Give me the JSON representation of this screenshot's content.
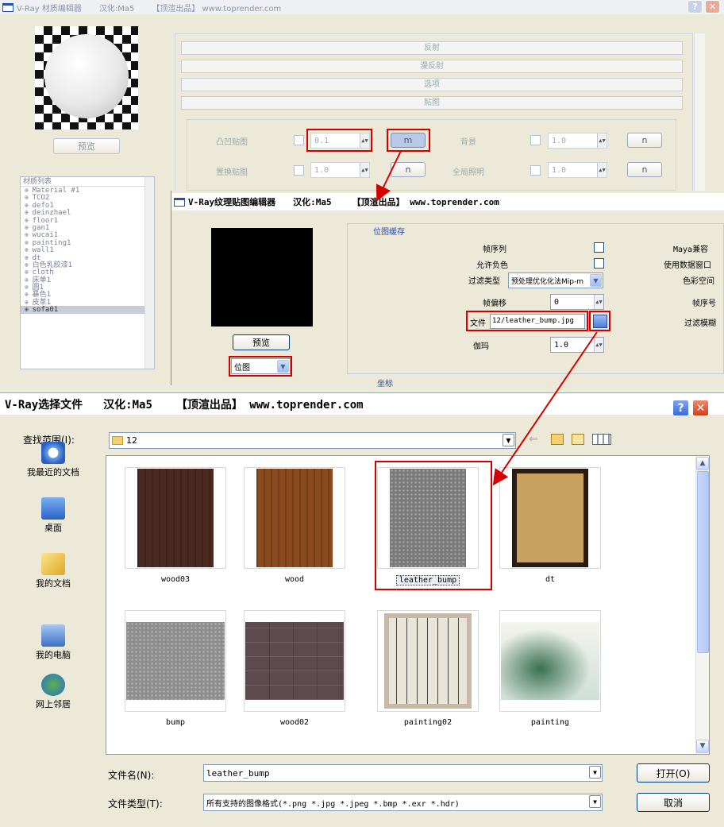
{
  "material_editor": {
    "title": "V-Ray 材质编辑器",
    "credit": "汉化:Ma5",
    "tag": "【顶渲出品】 www.toprender.com",
    "preview_button": "预览",
    "rollouts": [
      "反射",
      "漫反射",
      "选项",
      "贴图"
    ],
    "maps": {
      "bump_label": "凸凹贴图",
      "bump_value": "0.1",
      "displace_label": "置换贴图",
      "displace_value": "1.0",
      "background_label": "背景",
      "background_value": "1.0",
      "gi_label": "全局照明",
      "gi_value": "1.0",
      "map_button": "m",
      "none_button": "n"
    },
    "material_list_header": "材质列表",
    "material_list": [
      "Material #1",
      "TCO2",
      "defo1",
      "deinzhael",
      "floor1",
      "gan1",
      "wucai1",
      "painting1",
      "wall1",
      "dt",
      "白色乳胶漆1",
      "cloth",
      "床单1",
      "圆1",
      "暴色1",
      "皮革1",
      "sofa01"
    ],
    "material_selected": "sofa01"
  },
  "texture_editor": {
    "title": "V-Ray纹理贴图编辑器",
    "credit": "汉化:Ma5",
    "tag": "【顶渲出品】 www.toprender.com",
    "preview_button": "预览",
    "type_select": "位图",
    "group_label": "位图缓存",
    "rows": {
      "frame_seq": "帧序列",
      "allow_neg": "允许负色",
      "filter_type": "过滤类型",
      "filter_value": "预处理优化化法Mip-m",
      "frame_offset": "帧偏移",
      "frame_offset_value": "0",
      "file": "文件",
      "file_value": "12/leather_bump.jpg",
      "gamma": "伽玛",
      "gamma_value": "1.0"
    },
    "right_col": [
      "Maya兼容",
      "使用数据窗口",
      "色彩空间",
      "帧序号",
      "过滤模糊"
    ],
    "bottom_group": "坐标"
  },
  "file_dialog": {
    "title": "V-Ray选择文件",
    "credit": "汉化:Ma5",
    "tag": "【顶渲出品】 www.toprender.com",
    "look_in_label": "查找范围(I):",
    "look_in_value": "12",
    "places": [
      "我最近的文档",
      "桌面",
      "我的文档",
      "我的电脑",
      "网上邻居"
    ],
    "files": [
      {
        "name": "wood03",
        "thumb": "#4a2a20"
      },
      {
        "name": "wood",
        "thumb": "#8a4a1e"
      },
      {
        "name": "leather_bump",
        "thumb": "#7a7a7a"
      },
      {
        "name": "dt",
        "thumb": "#c8a060"
      },
      {
        "name": "bump",
        "thumb": "#8e8e8e"
      },
      {
        "name": "wood02",
        "thumb": "#5e4a4e"
      },
      {
        "name": "painting02",
        "thumb": "#e8e4d8"
      },
      {
        "name": "painting",
        "thumb": "#7aa090"
      }
    ],
    "selected_file": "leather_bump",
    "filename_label": "文件名(N):",
    "filename_value": "leather_bump",
    "filetype_label": "文件类型(T):",
    "filetype_value": "所有支持的图像格式(*.png *.jpg *.jpeg *.bmp *.exr *.hdr)",
    "open_button": "打开(O)",
    "cancel_button": "取消"
  },
  "colors": {
    "highlight": "#d40000",
    "xp_blue": "#316ac5"
  }
}
